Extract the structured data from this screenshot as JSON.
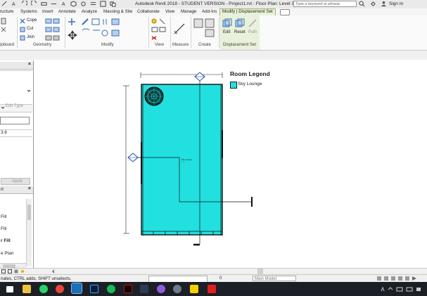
{
  "window": {
    "title": "Autodesk Revit 2018 - STUDENT VERSION -    Project1.rvt - Floor Plan: Level 3 Color Fill",
    "search_placeholder": "Type a keyword or phrase",
    "sign_in": "Sign In"
  },
  "ribbon_tabs": [
    "ructure",
    "Systems",
    "Insert",
    "Annotate",
    "Analyze",
    "Massing & Site",
    "Collaborate",
    "View",
    "Manage",
    "Add-Ins",
    "Modify | Displacement Set"
  ],
  "ribbon": {
    "cope": "Cope",
    "cut": "Cut",
    "join": "Join",
    "groups": [
      "ipboard",
      "Geometry",
      "Modify",
      "View",
      "Measure",
      "Create",
      "Displacement Set"
    ],
    "edit": "Edit",
    "reset": "Reset",
    "path": "Path"
  },
  "properties_panel": {
    "edit_type": "Edit Type",
    "value": "3.6",
    "apply": "Apply"
  },
  "browser_panel": {
    "title": "rt",
    "items": [
      "Fill",
      "Fill",
      "r Fill",
      "e Plan"
    ]
  },
  "legend": {
    "title": "Room Legend",
    "entries": [
      {
        "label": "Sky Lounge",
        "color": "#22e0e0"
      }
    ]
  },
  "room": {
    "fill_color": "#22e0e0",
    "tag": "Sky Lounge"
  },
  "status": {
    "message": "nates, CTRL adds, SHIFT unselects.",
    "scale_value": "0",
    "model": "Main Model"
  },
  "colors": {
    "context_tab": "#e8f1da",
    "taskbar": "#1c1f26",
    "room_fill": "#22e0e0"
  }
}
